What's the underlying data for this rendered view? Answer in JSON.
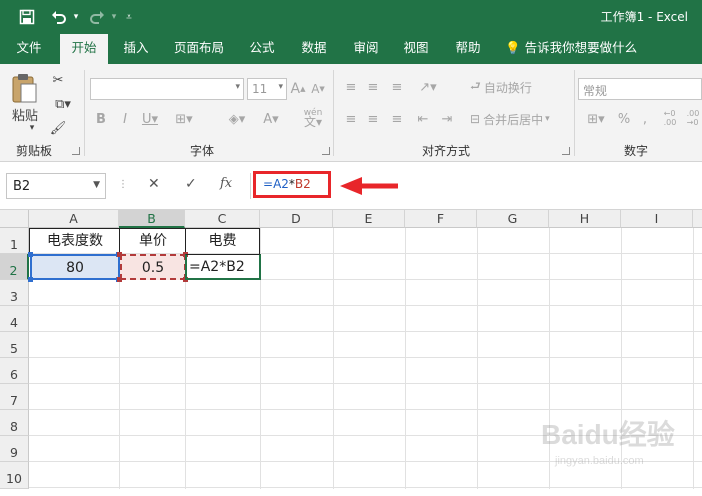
{
  "window": {
    "title": "工作簿1 - Excel",
    "qat": {
      "save_icon": "save-icon",
      "undo_icon": "undo-icon",
      "redo_icon": "redo-icon",
      "customize_icon": "customize-qat-icon"
    }
  },
  "ribbon": {
    "tabs": [
      "文件",
      "开始",
      "插入",
      "页面布局",
      "公式",
      "数据",
      "审阅",
      "视图",
      "帮助"
    ],
    "active_tab": "开始",
    "tell_me": "告诉我你想要做什么",
    "groups": {
      "clipboard": {
        "label": "剪贴板",
        "paste_label": "粘贴"
      },
      "font": {
        "label": "字体",
        "font_size": "11",
        "wen_label": "wén"
      },
      "alignment": {
        "label": "对齐方式",
        "wrap_text": "自动换行",
        "merge_center": "合并后居中"
      },
      "number": {
        "label": "数字",
        "format": "常规"
      }
    }
  },
  "formula_bar": {
    "name_box": "B2",
    "cancel_icon": "cancel-icon",
    "enter_icon": "enter-icon",
    "fx_label": "fx",
    "formula_parts": [
      "=",
      "A2",
      "*",
      "B2"
    ]
  },
  "sheet": {
    "columns": [
      "A",
      "B",
      "C",
      "D",
      "E",
      "F",
      "G",
      "H",
      "I"
    ],
    "rows": [
      "1",
      "2",
      "3",
      "4",
      "5",
      "6",
      "7",
      "8",
      "9",
      "10"
    ],
    "selected_cell": "B2",
    "cells": {
      "A1": "电表度数",
      "B1": "单价",
      "C1": "电费",
      "A2": "80",
      "B2": "0.5",
      "C2": "=A2*B2"
    }
  },
  "colors": {
    "excel_green": "#217346",
    "annotation_red": "#e8262a",
    "ref_blue": "#1f5fc5",
    "ref_red": "#c0392b"
  },
  "watermark": {
    "text": "Baidu经验",
    "sub": "jingyan.baidu.com"
  }
}
